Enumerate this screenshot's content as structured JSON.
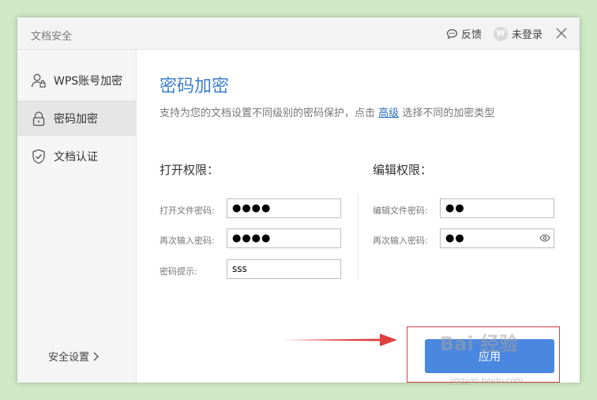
{
  "window": {
    "title": "文档安全",
    "feedback_label": "反馈",
    "login_label": "未登录",
    "avatar_letter": "W"
  },
  "sidebar": {
    "items": [
      {
        "label": "WPS账号加密",
        "icon": "user-lock-icon",
        "active": false
      },
      {
        "label": "密码加密",
        "icon": "lock-icon",
        "active": true
      },
      {
        "label": "文档认证",
        "icon": "shield-check-icon",
        "active": false
      }
    ],
    "security_settings_label": "安全设置"
  },
  "main": {
    "heading": "密码加密",
    "description_prefix": "支持为您的文档设置不同级别的密码保护，点击",
    "advanced_link": "高级",
    "description_suffix": "选择不同的加密类型",
    "open_permissions": {
      "title": "打开权限：",
      "password_label": "打开文件密码:",
      "password_value": "●●●●",
      "confirm_label": "再次输入密码:",
      "confirm_value": "●●●●",
      "hint_label": "密码提示:",
      "hint_value": "sss"
    },
    "edit_permissions": {
      "title": "编辑权限：",
      "password_label": "编辑文件密码:",
      "password_value": "●●",
      "confirm_label": "再次输入密码:",
      "confirm_value": "●●"
    },
    "apply_button": "应用"
  },
  "watermark": {
    "text": "Bai 经验",
    "subtext": "jingyan.baidu.com"
  },
  "colors": {
    "accent": "#4a87e0",
    "heading": "#3d7ec9",
    "annotation_red": "#d64040"
  }
}
